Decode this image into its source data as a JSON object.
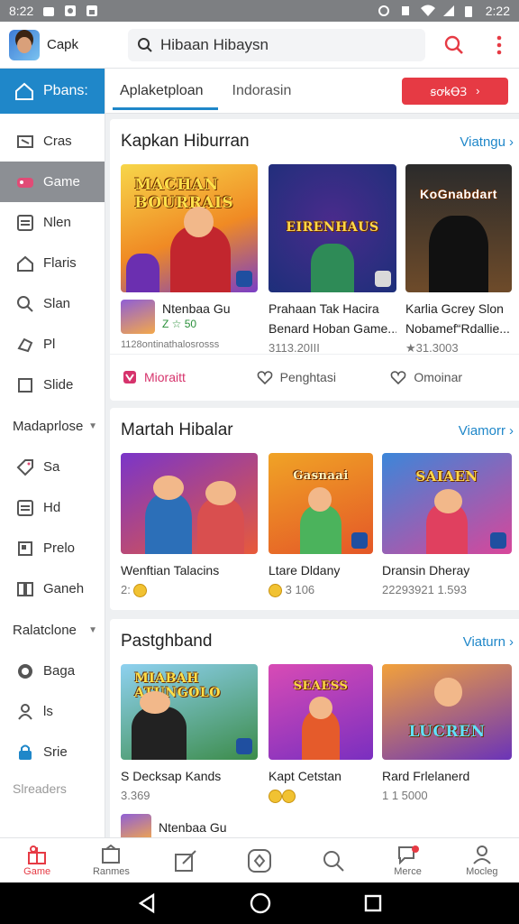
{
  "status_bar": {
    "time": "8:22",
    "clock_right": "2:22",
    "icons": [
      "bag-icon",
      "image-icon",
      "image-icon",
      "alarm-icon",
      "mute-icon",
      "wifi-icon",
      "signal-icon",
      "battery-icon"
    ]
  },
  "app_bar": {
    "app_name": "Capk",
    "search_text": "Hibaan Hibaysn",
    "icons": [
      "search-icon",
      "more-vert-icon"
    ],
    "accent": "#e63a44"
  },
  "sidebar": {
    "home_label": "Pbans:",
    "items_top": [
      {
        "label": "Cras",
        "icon": "cross-icon"
      },
      {
        "label": "Game",
        "icon": "gamepad-icon",
        "active": true
      },
      {
        "label": "Nlen",
        "icon": "list-icon"
      },
      {
        "label": "Flaris",
        "icon": "home-icon"
      },
      {
        "label": "Slan",
        "icon": "search-icon"
      },
      {
        "label": "Pl",
        "icon": "controller-icon"
      },
      {
        "label": "Slide",
        "icon": "square-icon"
      }
    ],
    "section1": "Madaprlose",
    "items_mid": [
      {
        "label": "Sa",
        "icon": "tag-icon"
      },
      {
        "label": "Hd",
        "icon": "list-icon"
      },
      {
        "label": "Prelo",
        "icon": "flag-icon"
      },
      {
        "label": "Ganeh",
        "icon": "columns-icon"
      }
    ],
    "section2": "Ralatclone",
    "items_bottom": [
      {
        "label": "Baga",
        "icon": "chat-icon"
      },
      {
        "label": "ls",
        "icon": "user-icon"
      },
      {
        "label": "Srie",
        "icon": "lock-icon"
      }
    ],
    "footer": "Slreaders"
  },
  "tabs": [
    {
      "label": "Aplaketploan",
      "active": true
    },
    {
      "label": "Indorasin",
      "active": false
    }
  ],
  "tab_action": {
    "label": "ꞩꝍꝃꝊꞫ",
    "arrow": "›"
  },
  "sections": [
    {
      "title": "Kapkan Hiburran",
      "more": "Viatngu",
      "tiles": [
        {
          "banner": "MACHAN BOURRAIS",
          "title": "Ntenbaa Gu",
          "sub": "1128ontinathalosrosss",
          "rating": "Z ☆ 50",
          "style": "warm"
        },
        {
          "banner": "EIRENHAUS",
          "title": "Prahaan Tak Hacira",
          "title2": "Benard Hoban Game...",
          "sub": "3113.20III",
          "style": "blue"
        },
        {
          "banner": "KoGnabdart",
          "title": "Karlia Gcrey Slon",
          "title2": "Nobamef“Rdallie...",
          "sub": "★31.3003",
          "style": "dark"
        }
      ],
      "actions": [
        "Mioraitt",
        "Penghtasi",
        "Omoinar"
      ]
    },
    {
      "title": "Martah Hibalar",
      "more": "Viamorr",
      "tiles": [
        {
          "title": "Wenftian Talacins",
          "sub": "2:",
          "style": "red"
        },
        {
          "banner": "Gasnaai",
          "title": "Ltare Dldany",
          "sub": "3 106",
          "style": "orange"
        },
        {
          "banner": "SAIAEN",
          "title": "Dransin Dheray",
          "sub": "22293921 1.593",
          "style": "pink"
        }
      ]
    },
    {
      "title": "Pastghband",
      "more": "Viaturn",
      "tiles": [
        {
          "banner": "MIABAH ATUNGOLO",
          "title": "S Decksap Kands",
          "sub": "3.369",
          "style": "green"
        },
        {
          "banner": "SEAESS",
          "title": "Kapt Cetstan",
          "sub": "",
          "style": "purple"
        },
        {
          "banner": "LUCREN",
          "title": "Rard Frlelanerd",
          "sub": "1 1 5000",
          "style": "sunset"
        }
      ],
      "mini_title": "Ntenbaa Gu"
    }
  ],
  "bottom_nav": [
    {
      "label": "Game",
      "icon": "gift-icon",
      "active": true
    },
    {
      "label": "Ranmes",
      "icon": "ranking-icon"
    },
    {
      "label": "",
      "icon": "pen-icon"
    },
    {
      "label": "",
      "icon": "shield-icon"
    },
    {
      "label": "",
      "icon": "search-icon"
    },
    {
      "label": "Merce",
      "icon": "chat-icon"
    },
    {
      "label": "Mocleg",
      "icon": "user-icon"
    }
  ]
}
